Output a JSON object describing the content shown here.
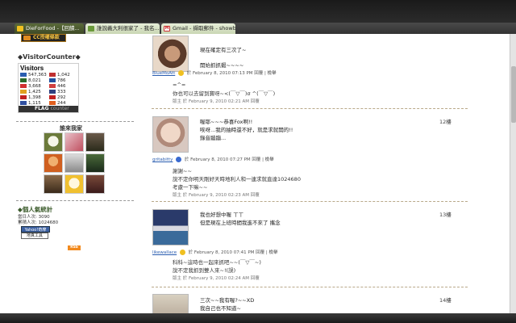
{
  "tabs": [
    {
      "label": "DieForFood -【回饋..."
    },
    {
      "label": "誰說義大利很家了 - 我名..."
    },
    {
      "label": "Gmail - 擷取郵件 - showb..."
    }
  ],
  "sidebar": {
    "cc_banner": "CC授權條款",
    "visitor_counter_heading": "◆VisitorCounter◆",
    "visitors_title": "Visitors",
    "visitor_counts": [
      {
        "count": "547,363",
        "color": "#2a5db0"
      },
      {
        "count": "8,021",
        "color": "#2a6a2a"
      },
      {
        "count": "3,668",
        "color": "#d03030"
      },
      {
        "count": "1,425",
        "color": "#e0a020"
      },
      {
        "count": "1,398",
        "color": "#c02020"
      },
      {
        "count": "1,115",
        "color": "#3050a0"
      }
    ],
    "visitor_counts_right": [
      {
        "count": "1,042",
        "color": "#c03030"
      },
      {
        "count": "786",
        "color": "#2050a0"
      },
      {
        "count": "446",
        "color": "#d04040"
      },
      {
        "count": "333",
        "color": "#304080"
      },
      {
        "count": "292",
        "color": "#c02020"
      },
      {
        "count": "244",
        "color": "#e06020"
      }
    ],
    "flag_counter_label": "FLAG",
    "flag_counter_suffix": "counter",
    "visitors_heading": "誰來我家",
    "stats_heading": "◆個人氣統計",
    "stats_today": "當日人次: 3090",
    "stats_total": "累積人次: 1024680",
    "yahoo_button": "Yahoo!奇摩",
    "tool_button": "地真工具",
    "rss_badge": "RSS"
  },
  "comments": [
    {
      "lines": [
        "現在確定有三次了~",
        "",
        "開始抓抓蝦~~~~"
      ],
      "floor": "",
      "author": "BlueMoAtt",
      "meta": "於 February 8, 2010 07:13 PM 回覆",
      "edit": "檢舉",
      "reply_lines": [
        "=^=",
        "你也可以去留到寶呀~<(￣▽￣)σ ^(￣▽￣)"
      ],
      "reply_meta": "版主 於 February 9, 2010 02:21 AM 回覆"
    },
    {
      "lines": [
        "喔耶~~~恭喜Fox啊!!",
        "唉呀...我的抽時還不好，就是求就開的!!",
        "錄音蹦蹦..."
      ],
      "floor": "12樓",
      "author": "gritabitty",
      "meta": "於 February 8, 2010 07:27 PM 回覆",
      "edit": "檢舉",
      "reply_lines": [
        "謝謝~~",
        "說不定你明天剛好天時地利人和一連求就直達1024680",
        "考慮一下嘛~~"
      ],
      "reply_meta": "版主 於 February 9, 2010 02:23 AM 回覆"
    },
    {
      "lines": [
        "我也好想中喔 ㄒㄒ",
        "但是現在上班時間我進不來了 攜念"
      ],
      "floor": "13樓",
      "author": "likewallace",
      "meta": "於 February 8, 2010 07:41 PM 回覆",
      "edit": "檢舉",
      "reply_lines": [
        "科科~這時也一起來抓吧~~(￣▽￣~)",
        "說不定我抓到雙人來~!(誤)"
      ],
      "reply_meta": "版主 於 February 9, 2010 02:24 AM 回覆"
    },
    {
      "lines": [
        "三次~~我有喔?~~XD",
        "我自己也不知道~"
      ],
      "floor": "14樓",
      "author": "",
      "meta": "",
      "edit": "",
      "reply_lines": [],
      "reply_meta": ""
    }
  ]
}
